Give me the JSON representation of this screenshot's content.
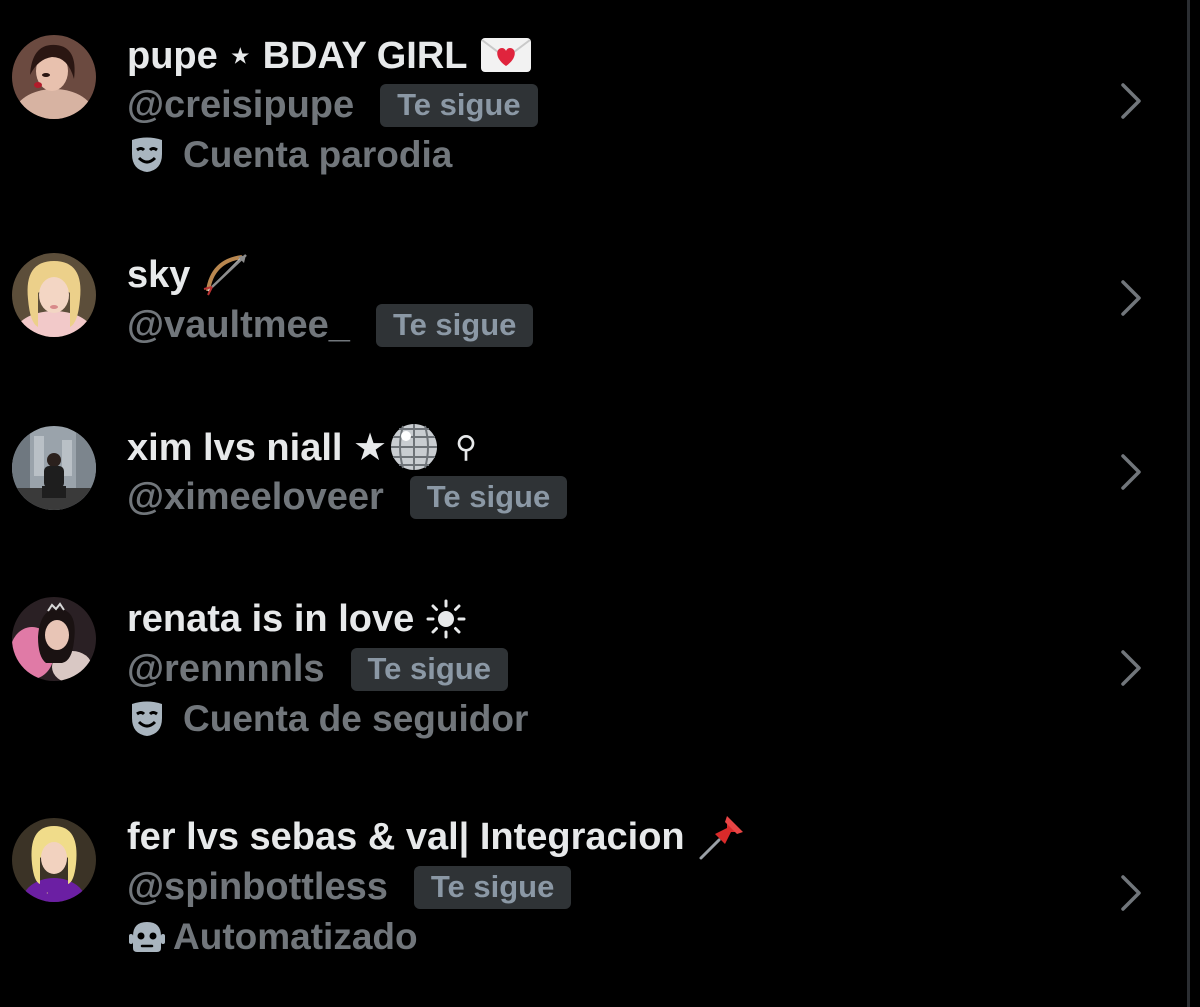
{
  "accounts": [
    {
      "display_name": "pupe ⋆ BDAY GIRL",
      "name_emoji": "love-letter-icon",
      "handle": "@creisipupe",
      "follows_you": "Te sigue",
      "label_icon": "parody-mask-icon",
      "label": "Cuenta parodia"
    },
    {
      "display_name": "sky",
      "name_emoji": "bow-and-arrow-icon",
      "handle": "@vaultmee_",
      "follows_you": "Te sigue"
    },
    {
      "display_name": "xim lvs niall ★",
      "name_emoji": "disco-ball-icon",
      "name_suffix": "⚲",
      "handle": "@ximeeloveer",
      "follows_you": "Te sigue"
    },
    {
      "display_name": "renata is in love",
      "name_emoji": "sun-icon",
      "handle": "@rennnnls",
      "follows_you": "Te sigue",
      "label_icon": "parody-mask-icon",
      "label": "Cuenta de seguidor"
    },
    {
      "display_name": "fer lvs sebas & val| Integracion",
      "name_emoji": "pushpin-icon",
      "handle": "@spinbottless",
      "follows_you": "Te sigue",
      "label_icon": "bot-icon",
      "label": "Automatizado"
    }
  ],
  "colors": {
    "background": "#000000",
    "primary_text": "#e7e9ea",
    "secondary_text": "#71767b",
    "badge_bg": "#2f3336"
  }
}
